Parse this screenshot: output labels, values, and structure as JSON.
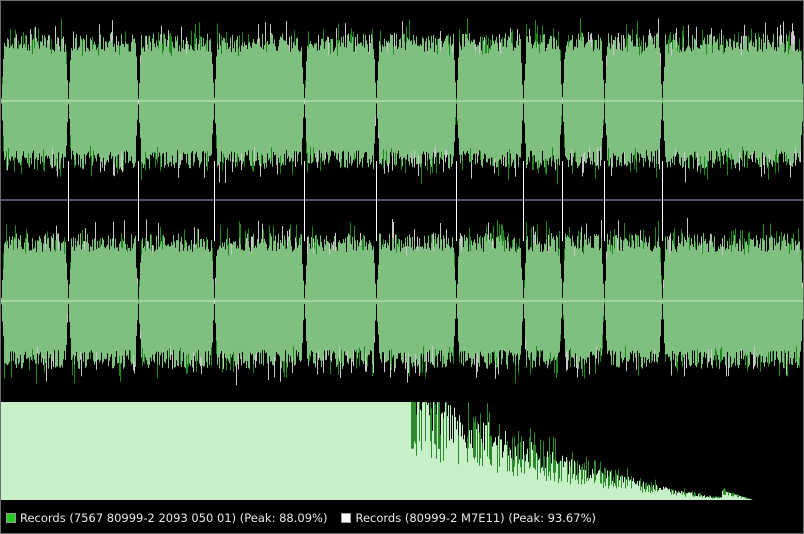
{
  "window": {
    "background": "#000000"
  },
  "legend": {
    "items": [
      {
        "label": "Records (7567 80999-2 2093 050 01) (Peak: 88.09%)",
        "color": "#22cc22"
      },
      {
        "label": "Records (80999-2 M7E11) (Peak: 93.67%)",
        "color": "#ffffff"
      }
    ]
  },
  "colors": {
    "wave_fill": "#7fbf7f",
    "wave_dark": "#1e8a1e",
    "wave_light": "#c8c8c8",
    "centerline": "#cfe8cf",
    "divider": "#6e6e8a",
    "track_marker": "#ffffff",
    "spectrum_fill": "#c8f0c8",
    "spectrum_dark": "#2c8a2c"
  },
  "track_markers_seconds": [
    0.0,
    0.083,
    0.171,
    0.265,
    0.378,
    0.468,
    0.567,
    0.651,
    0.699,
    0.752,
    0.824
  ]
}
